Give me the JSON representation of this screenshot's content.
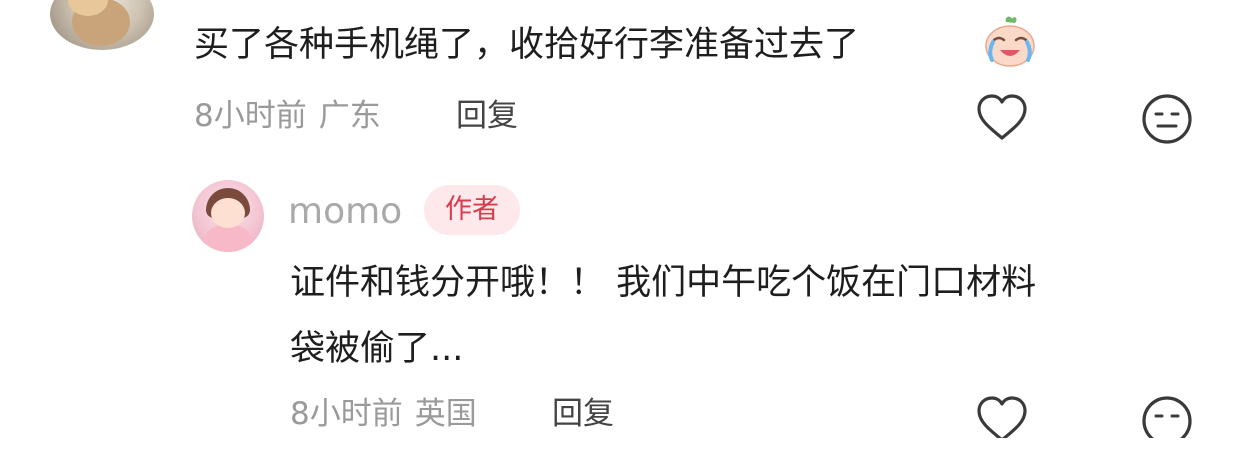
{
  "comment": {
    "text": "买了各种手机绳了，收拾好行李准备过去了",
    "emoji_icon": "crying-face-emoji",
    "time": "8小时前",
    "location": "广东",
    "reply_label": "回复",
    "like_icon": "heart-outline-icon",
    "dislike_icon": "neutral-face-icon"
  },
  "reply": {
    "username": "momo",
    "badge": "作者",
    "text_line1": "证件和钱分开哦！！  我们中午吃个饭在门口材料",
    "text_line2": "袋被偷了...",
    "time": "8小时前",
    "location": "英国",
    "reply_label": "回复",
    "like_icon": "heart-outline-icon",
    "dislike_icon": "neutral-face-icon"
  },
  "colors": {
    "meta_gray": "#9a9a9a",
    "badge_bg": "#fde9ec",
    "badge_text": "#d83a4e",
    "text": "#1e1e1e"
  }
}
